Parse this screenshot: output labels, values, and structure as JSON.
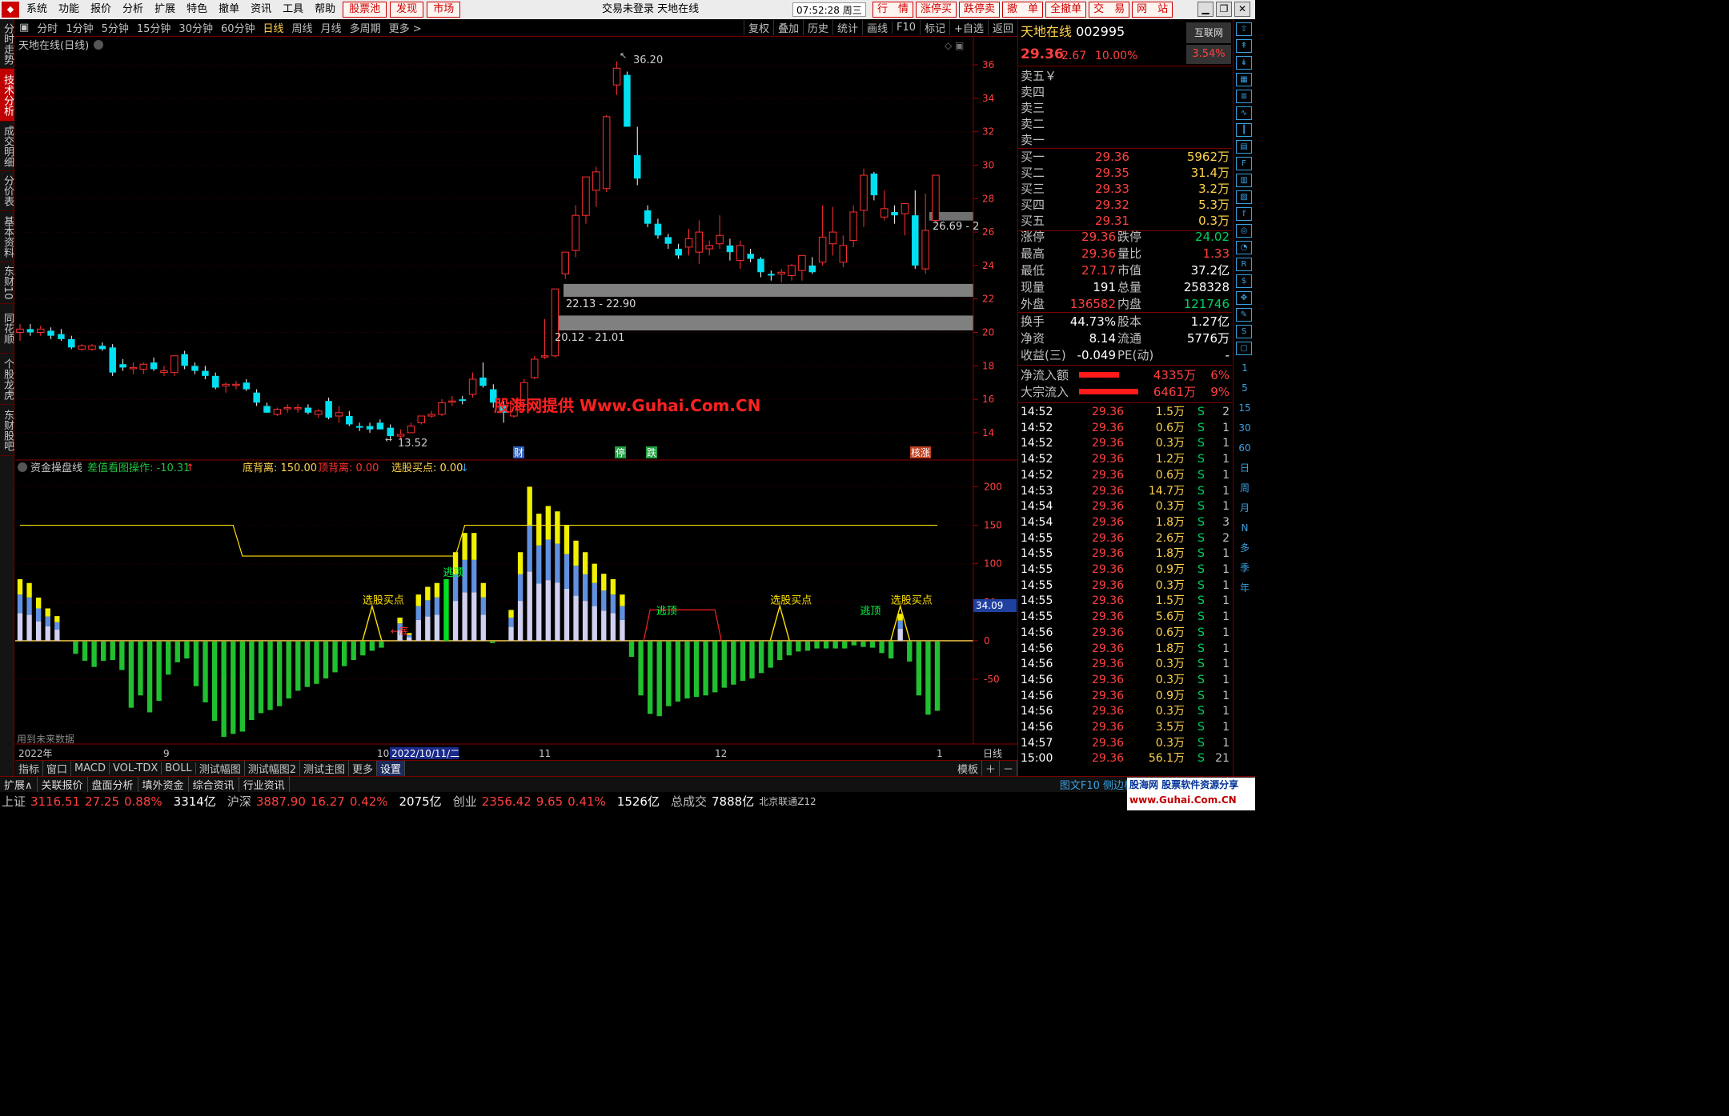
{
  "menubar": {
    "items": [
      "系统",
      "功能",
      "报价",
      "分析",
      "扩展",
      "特色",
      "撤单",
      "资讯",
      "工具",
      "帮助"
    ],
    "red_items": [
      "股票池",
      "发现",
      "市场"
    ],
    "title": "交易未登录  天地在线",
    "clock": "07:52:28 周三",
    "right_buttons": [
      "行　情",
      "涨停买",
      "跌停卖",
      "撤　单",
      "全撤单",
      "交　易",
      "网　站"
    ]
  },
  "left_tabs": [
    "分时走势",
    "技术分析",
    "成交明细",
    "分价表",
    "基本资料",
    "东财10",
    "同花顺10",
    "个股龙虎",
    "东财股吧"
  ],
  "period_bar": {
    "periods": [
      "分时",
      "1分钟",
      "5分钟",
      "15分钟",
      "30分钟",
      "60分钟",
      "日线",
      "周线",
      "月线",
      "多周期",
      "更多 >"
    ],
    "active": "日线",
    "tools": [
      "复权",
      "叠加",
      "历史",
      "统计",
      "画线",
      "F10",
      "标记",
      "+自选",
      "返回"
    ]
  },
  "main_chart": {
    "title": "天地在线(日线)",
    "high_label": "36.20",
    "low_label": "13.52",
    "zone_labels": [
      "22.13 - 22.90",
      "20.12 - 21.01",
      "26.69 - 2"
    ],
    "event_tags": [
      {
        "text": "财",
        "color": "#3060c0"
      },
      {
        "text": "停",
        "color": "#20a040"
      },
      {
        "text": "跌",
        "color": "#20a040"
      },
      {
        "text": "核涨",
        "color": "#c04020"
      }
    ],
    "watermark": "股海网提供 Www.Guhai.Com.CN"
  },
  "sub_chart": {
    "name": "资金操盘线",
    "param": "差值看图操作: -10.31",
    "bottom": "底背离: 150.00",
    "top": "顶背离: 0.00",
    "signal": "选股买点: 0.00",
    "signal_labels": {
      "buy": "选股买点",
      "top": "逃顶",
      "bottom": "←底"
    },
    "current_value": "34.09",
    "future_note": "用到未来数据"
  },
  "date_axis": {
    "labels": [
      "2022年",
      "9",
      "10",
      "11",
      "12",
      "1"
    ],
    "selected": "2022/10/11/二",
    "period": "日线"
  },
  "bottom_tabs": [
    "指标",
    "窗口",
    "MACD",
    "VOL-TDX",
    "BOLL",
    "测试幅图",
    "测试幅图2",
    "测试主图",
    "更多",
    "设置"
  ],
  "bottom_right": "模板",
  "ext_bar": [
    "扩展∧",
    "关联报价",
    "盘面分析",
    "填外资金",
    "综合资讯",
    "行业资讯"
  ],
  "ext_right": "图文F10 侧边栏《",
  "quote_tabs": [
    "笔",
    "价",
    "细",
    "势"
  ],
  "quote": {
    "name": "天地在线",
    "code": "002995",
    "market": "互联网",
    "price": "29.36",
    "change": "2.67",
    "pct": "10.00%",
    "industry_pct": "3.54%",
    "asks": [
      "卖五￥",
      "卖四",
      "卖三",
      "卖二",
      "卖一"
    ],
    "bids": [
      {
        "label": "买一",
        "price": "29.36",
        "vol": "5962万"
      },
      {
        "label": "买二",
        "price": "29.35",
        "vol": "31.4万"
      },
      {
        "label": "买三",
        "price": "29.33",
        "vol": "3.2万"
      },
      {
        "label": "买四",
        "price": "29.32",
        "vol": "5.3万"
      },
      {
        "label": "买五",
        "price": "29.31",
        "vol": "0.3万"
      }
    ],
    "stats": [
      {
        "l1": "涨停",
        "v1": "29.36",
        "c1": "red",
        "l2": "跌停",
        "v2": "24.02",
        "c2": "grn"
      },
      {
        "l1": "最高",
        "v1": "29.36",
        "c1": "red",
        "l2": "量比",
        "v2": "1.33",
        "c2": "red"
      },
      {
        "l1": "最低",
        "v1": "27.17",
        "c1": "red",
        "l2": "市值",
        "v2": "37.2亿",
        "c2": "wht"
      },
      {
        "l1": "现量",
        "v1": "191",
        "c1": "wht",
        "l2": "总量",
        "v2": "258328",
        "c2": "wht"
      },
      {
        "l1": "外盘",
        "v1": "136582",
        "c1": "red",
        "l2": "内盘",
        "v2": "121746",
        "c2": "grn"
      }
    ],
    "stats2": [
      {
        "l1": "换手",
        "v1": "44.73%",
        "l2": "股本",
        "v2": "1.27亿"
      },
      {
        "l1": "净资",
        "v1": "8.14",
        "l2": "流通",
        "v2": "5776万"
      },
      {
        "l1": "收益(三)",
        "v1": "-0.049",
        "l2": "PE(动)",
        "v2": "-"
      }
    ],
    "flows": [
      {
        "label": "净流入额",
        "value": "4335万",
        "pct": "6%"
      },
      {
        "label": "大宗流入",
        "value": "6461万",
        "pct": "9%"
      }
    ],
    "ticks": [
      [
        "14:52",
        "29.36",
        "1.5万",
        "S",
        "2"
      ],
      [
        "14:52",
        "29.36",
        "0.6万",
        "S",
        "1"
      ],
      [
        "14:52",
        "29.36",
        "0.3万",
        "S",
        "1"
      ],
      [
        "14:52",
        "29.36",
        "1.2万",
        "S",
        "1"
      ],
      [
        "14:52",
        "29.36",
        "0.6万",
        "S",
        "1"
      ],
      [
        "14:53",
        "29.36",
        "14.7万",
        "S",
        "1"
      ],
      [
        "14:54",
        "29.36",
        "0.3万",
        "S",
        "1"
      ],
      [
        "14:54",
        "29.36",
        "1.8万",
        "S",
        "3"
      ],
      [
        "14:55",
        "29.36",
        "2.6万",
        "S",
        "2"
      ],
      [
        "14:55",
        "29.36",
        "1.8万",
        "S",
        "1"
      ],
      [
        "14:55",
        "29.36",
        "0.9万",
        "S",
        "1"
      ],
      [
        "14:55",
        "29.36",
        "0.3万",
        "S",
        "1"
      ],
      [
        "14:55",
        "29.36",
        "1.5万",
        "S",
        "1"
      ],
      [
        "14:55",
        "29.36",
        "5.6万",
        "S",
        "1"
      ],
      [
        "14:56",
        "29.36",
        "0.6万",
        "S",
        "1"
      ],
      [
        "14:56",
        "29.36",
        "1.8万",
        "S",
        "1"
      ],
      [
        "14:56",
        "29.36",
        "0.3万",
        "S",
        "1"
      ],
      [
        "14:56",
        "29.36",
        "0.3万",
        "S",
        "1"
      ],
      [
        "14:56",
        "29.36",
        "0.9万",
        "S",
        "1"
      ],
      [
        "14:56",
        "29.36",
        "0.3万",
        "S",
        "1"
      ],
      [
        "14:56",
        "29.36",
        "3.5万",
        "S",
        "1"
      ],
      [
        "14:57",
        "29.36",
        "0.3万",
        "S",
        "1"
      ],
      [
        "15:00",
        "29.36",
        "56.1万",
        "S",
        "21"
      ]
    ]
  },
  "right_toolbar_labels": [
    "1",
    "5",
    "15",
    "30",
    "60",
    "日",
    "周",
    "月",
    "N",
    "多",
    "季",
    "年"
  ],
  "status": {
    "sh": {
      "name": "上证",
      "val": "3116.51",
      "chg": "27.25",
      "pct": "0.88%",
      "amt": "3314亿"
    },
    "sz": {
      "name": "沪深",
      "val": "3887.90",
      "chg": "16.27",
      "pct": "0.42%",
      "amt": "2075亿"
    },
    "cy": {
      "name": "创业",
      "val": "2356.42",
      "chg": "9.65",
      "pct": "0.41%",
      "amt": "1526亿"
    },
    "total_label": "总成交",
    "total": "7888亿",
    "extra": "北京联通Z12"
  },
  "brand": {
    "line1": "股海网 股票软件资源分享",
    "line2": "www.Guhai.Com.CN"
  },
  "chart_data": [
    {
      "type": "candlestick",
      "title": "天地在线(日线)",
      "y_ticks": [
        14,
        16,
        18,
        20,
        22,
        24,
        26,
        28,
        30,
        32,
        34,
        36
      ],
      "ylim": [
        12.8,
        37.2
      ],
      "candles": [
        [
          20.0,
          20.5,
          19.5,
          20.2
        ],
        [
          20.2,
          20.5,
          19.8,
          20.0
        ],
        [
          20.0,
          20.4,
          19.8,
          20.2
        ],
        [
          20.1,
          20.3,
          19.6,
          19.8
        ],
        [
          19.9,
          20.2,
          19.5,
          19.6
        ],
        [
          19.6,
          19.8,
          19.0,
          19.1
        ],
        [
          19.0,
          19.3,
          18.9,
          19.2
        ],
        [
          19.0,
          19.3,
          18.9,
          19.2
        ],
        [
          19.2,
          19.4,
          18.9,
          19.0
        ],
        [
          19.1,
          19.3,
          17.4,
          17.6
        ],
        [
          18.1,
          18.4,
          17.7,
          17.9
        ],
        [
          17.9,
          18.2,
          17.5,
          17.9
        ],
        [
          17.8,
          18.2,
          17.5,
          18.1
        ],
        [
          18.2,
          18.5,
          17.7,
          17.8
        ],
        [
          17.6,
          18.0,
          17.4,
          17.7
        ],
        [
          17.6,
          18.6,
          17.4,
          18.6
        ],
        [
          18.7,
          18.9,
          17.8,
          18.0
        ],
        [
          18.0,
          18.2,
          17.5,
          17.7
        ],
        [
          17.7,
          18.0,
          17.2,
          17.4
        ],
        [
          17.4,
          17.6,
          16.6,
          16.7
        ],
        [
          16.8,
          17.0,
          16.4,
          16.9
        ],
        [
          16.9,
          17.1,
          16.6,
          16.9
        ],
        [
          17.0,
          17.2,
          16.5,
          16.6
        ],
        [
          16.4,
          16.6,
          15.6,
          15.8
        ],
        [
          15.6,
          15.8,
          15.2,
          15.2
        ],
        [
          15.1,
          15.5,
          15.0,
          15.4
        ],
        [
          15.5,
          15.7,
          15.2,
          15.5
        ],
        [
          15.5,
          15.7,
          15.2,
          15.5
        ],
        [
          15.5,
          15.7,
          15.1,
          15.2
        ],
        [
          15.1,
          15.4,
          14.9,
          15.3
        ],
        [
          15.9,
          16.1,
          14.8,
          14.9
        ],
        [
          15.0,
          15.6,
          14.6,
          15.2
        ],
        [
          15.0,
          15.3,
          14.4,
          14.5
        ],
        [
          14.4,
          14.6,
          14.1,
          14.3
        ],
        [
          14.4,
          14.6,
          14.0,
          14.2
        ],
        [
          14.6,
          14.8,
          14.2,
          14.2
        ],
        [
          14.3,
          14.5,
          13.5,
          13.8
        ],
        [
          13.8,
          14.2,
          13.6,
          13.9
        ],
        [
          14.0,
          14.6,
          14.0,
          14.4
        ],
        [
          14.6,
          15.0,
          14.5,
          15.0
        ],
        [
          15.0,
          15.3,
          14.9,
          15.1
        ],
        [
          15.1,
          16.0,
          15.0,
          15.8
        ],
        [
          15.9,
          16.2,
          15.6,
          15.9
        ],
        [
          16.0,
          16.2,
          15.7,
          15.9
        ],
        [
          16.3,
          17.6,
          16.1,
          17.2
        ],
        [
          17.3,
          18.2,
          16.7,
          16.8
        ],
        [
          16.6,
          16.9,
          15.5,
          15.8
        ],
        [
          15.6,
          15.9,
          14.6,
          15.2
        ],
        [
          15.0,
          16.0,
          14.9,
          15.9
        ],
        [
          15.7,
          17.2,
          15.6,
          17.0
        ],
        [
          17.3,
          18.6,
          17.2,
          18.4
        ],
        [
          18.6,
          20.8,
          18.4,
          18.6
        ],
        [
          18.6,
          22.6,
          18.5,
          22.6
        ],
        [
          23.5,
          24.8,
          23.2,
          24.8
        ],
        [
          24.9,
          27.6,
          24.5,
          27.0
        ],
        [
          27.0,
          29.3,
          26.5,
          29.3
        ],
        [
          28.5,
          29.9,
          27.5,
          29.6
        ],
        [
          28.6,
          33.0,
          28.4,
          32.9
        ],
        [
          34.8,
          36.2,
          34.2,
          35.8
        ],
        [
          35.4,
          35.6,
          32.3,
          32.3
        ],
        [
          30.6,
          32.3,
          28.8,
          29.2
        ],
        [
          27.3,
          27.6,
          26.3,
          26.5
        ],
        [
          26.5,
          26.8,
          25.6,
          25.8
        ],
        [
          25.7,
          25.9,
          25.0,
          25.3
        ],
        [
          25.0,
          25.3,
          24.4,
          24.6
        ],
        [
          25.1,
          26.2,
          24.6,
          25.6
        ],
        [
          24.8,
          26.7,
          24.1,
          26.0
        ],
        [
          25.0,
          25.5,
          24.6,
          25.2
        ],
        [
          25.3,
          27.0,
          25.0,
          25.8
        ],
        [
          25.2,
          25.6,
          24.3,
          24.8
        ],
        [
          24.3,
          25.5,
          23.8,
          25.2
        ],
        [
          24.7,
          25.0,
          24.2,
          24.4
        ],
        [
          24.4,
          24.5,
          23.3,
          23.6
        ],
        [
          23.5,
          23.7,
          23.1,
          23.4
        ],
        [
          23.5,
          23.8,
          23.0,
          23.6
        ],
        [
          23.4,
          24.1,
          23.1,
          24.0
        ],
        [
          23.7,
          24.6,
          23.1,
          24.6
        ],
        [
          24.0,
          24.5,
          23.5,
          23.6
        ],
        [
          24.2,
          27.6,
          24.0,
          25.7
        ],
        [
          25.3,
          27.5,
          24.6,
          26.0
        ],
        [
          24.2,
          25.8,
          23.9,
          25.2
        ],
        [
          25.5,
          27.6,
          25.1,
          27.2
        ],
        [
          27.3,
          29.8,
          26.3,
          29.4
        ],
        [
          29.5,
          29.6,
          27.9,
          28.2
        ],
        [
          26.9,
          28.5,
          26.7,
          27.4
        ],
        [
          27.2,
          27.6,
          26.5,
          27.0
        ],
        [
          27.1,
          27.7,
          25.8,
          27.7
        ],
        [
          27.0,
          28.5,
          23.8,
          24.0
        ],
        [
          23.8,
          28.3,
          23.5,
          26.1
        ],
        [
          26.7,
          29.4,
          26.5,
          29.4
        ]
      ],
      "zones": [
        {
          "low": 22.13,
          "high": 22.9,
          "label": "22.13 - 22.90"
        },
        {
          "low": 20.12,
          "high": 21.01,
          "label": "20.12 - 21.01"
        },
        {
          "low": 26.69,
          "high": 27.2,
          "label": "26.69 - 2"
        }
      ],
      "high": 36.2,
      "low": 13.52
    },
    {
      "type": "bar",
      "title": "资金操盘线",
      "y_ticks": [
        200,
        150,
        100,
        50,
        0,
        -50
      ],
      "ylim": [
        -130,
        215
      ],
      "values": [
        80,
        75,
        56,
        42,
        32,
        0,
        -16,
        -25,
        -33,
        -25,
        -24,
        -37,
        -86,
        -70,
        -92,
        -77,
        -43,
        -27,
        -22,
        -58,
        -79,
        -103,
        -124,
        -120,
        -117,
        -102,
        -93,
        -89,
        -84,
        -74,
        -64,
        -59,
        -55,
        -48,
        -40,
        -32,
        -24,
        -18,
        -12,
        -8,
        0,
        30,
        10,
        60,
        70,
        75,
        80,
        115,
        140,
        140,
        75,
        -2,
        0,
        40,
        115,
        200,
        165,
        175,
        168,
        150,
        130,
        115,
        100,
        87,
        80,
        60,
        -20,
        -70,
        -94,
        -97,
        -84,
        -78,
        -74,
        -72,
        -70,
        -66,
        -60,
        -56,
        -51,
        -48,
        -41,
        -34,
        -24,
        -18,
        -13,
        -12,
        -9,
        -9,
        -9,
        -9,
        -5,
        -7,
        -8,
        -15,
        -22,
        35,
        -26,
        -70,
        -95,
        -90
      ],
      "level_line": [
        150,
        150,
        150,
        150,
        150,
        150,
        150,
        150,
        150,
        150,
        150,
        150,
        150,
        150,
        150,
        150,
        150,
        150,
        150,
        150,
        150,
        150,
        150,
        150,
        110,
        110,
        110,
        110,
        110,
        110,
        110,
        110,
        110,
        110,
        110,
        110,
        110,
        110,
        110,
        110,
        110,
        110,
        110,
        110,
        110,
        110,
        110,
        110,
        150,
        150,
        150,
        150,
        150,
        150,
        150,
        150,
        150,
        150,
        150,
        150,
        150,
        150,
        150,
        150,
        150,
        150,
        150,
        150,
        150,
        150,
        150,
        150,
        150,
        150,
        150,
        150,
        150,
        150,
        150,
        150,
        150,
        150,
        150,
        150,
        150,
        150,
        150,
        150,
        150,
        150,
        150,
        150,
        150,
        150,
        150,
        150,
        150,
        150,
        150,
        150
      ],
      "signals": [
        {
          "index": 38,
          "label": "选股买点"
        },
        {
          "index": 46,
          "label": "逃顶"
        },
        {
          "index": 69,
          "label": "逃顶"
        },
        {
          "index": 82,
          "label": "选股买点"
        },
        {
          "index": 91,
          "label": "逃顶"
        },
        {
          "index": 95,
          "label": "选股买点"
        }
      ]
    }
  ]
}
